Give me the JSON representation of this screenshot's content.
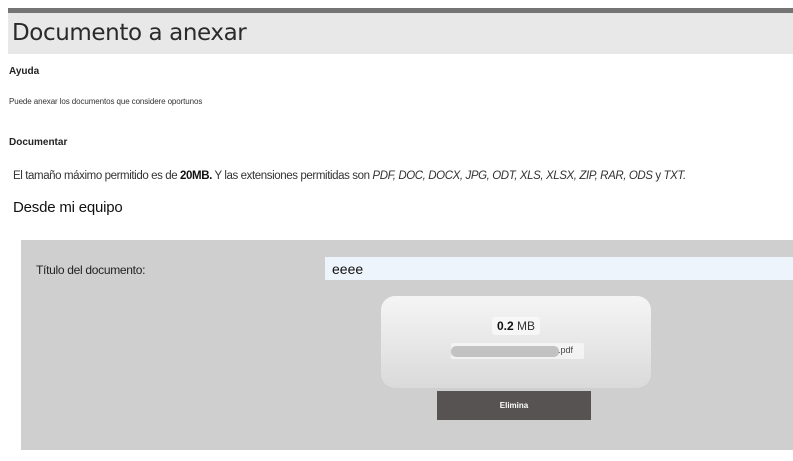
{
  "header": {
    "title": "Documento a anexar"
  },
  "help": {
    "heading": "Ayuda",
    "text": "Puede anexar los documentos que considere oportunos"
  },
  "document": {
    "heading": "Documentar",
    "limits_prefix": "El tamaño máximo permitido es de ",
    "max_size": "20MB.",
    "limits_middle": " Y las extensiones permitidas son ",
    "extensions": "PDF, DOC, DOCX, JPG, ODT, XLS, XLSX, ZIP, RAR, ODS",
    "limits_and": " y ",
    "last_extension": "TXT."
  },
  "upload": {
    "heading": "Desde mi equipo",
    "title_label": "Título del documento:",
    "title_value": "eeee",
    "file_size_value": "0.2",
    "file_size_unit": "MB",
    "file_extension": ".pdf",
    "delete_label": "Elimina"
  }
}
